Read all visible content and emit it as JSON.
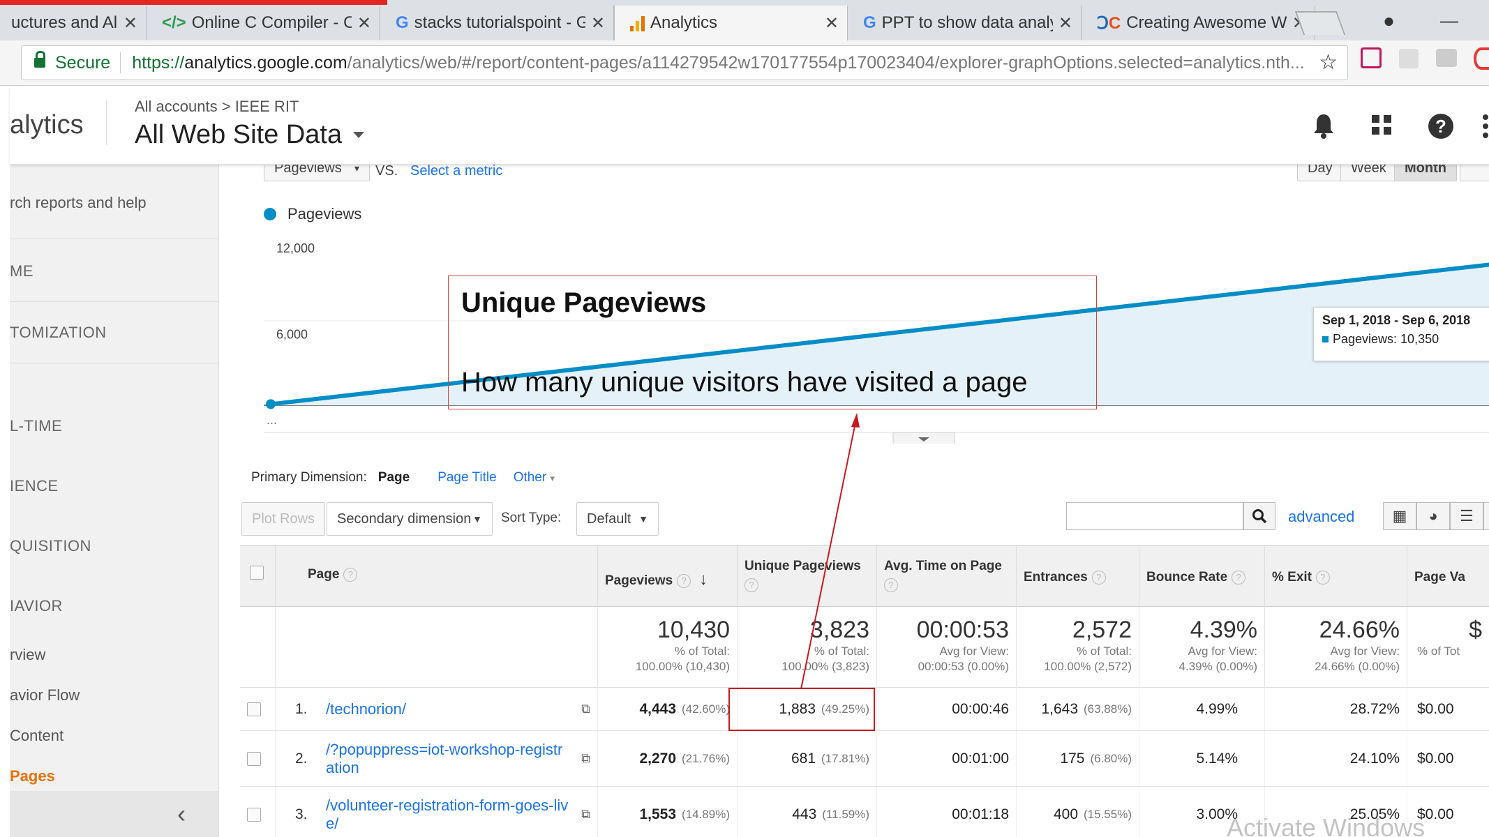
{
  "browser": {
    "tabs": [
      {
        "label": "uctures and Alg",
        "icon": "",
        "active": false
      },
      {
        "label": "Online C Compiler - Onl",
        "icon": "</>",
        "active": false
      },
      {
        "label": "stacks tutorialspoint - G",
        "icon": "G",
        "active": false
      },
      {
        "label": "Analytics",
        "icon": "analytics-bars",
        "active": true
      },
      {
        "label": "PPT to show data analyt",
        "icon": "G",
        "active": false
      },
      {
        "label": "Creating Awesome Web",
        "icon": "dc",
        "active": false
      }
    ],
    "close_glyph": "✕",
    "secure_label": "Secure",
    "url_proto": "https://",
    "url_host": "analytics.google.com",
    "url_path": "/analytics/web/#/report/content-pages/a114279542w170177554p170023404/explorer-graphOptions.selected=analytics.nth..."
  },
  "ga": {
    "brand": "alytics",
    "breadcrumb": "All accounts > IEEE RIT",
    "property": "All Web Site Data"
  },
  "sidebar": {
    "search": "rch reports and help",
    "home": "ME",
    "customization": "TOMIZATION",
    "realtime": "L-TIME",
    "audience": "IENCE",
    "acquisition": "QUISITION",
    "behavior": "IAVIOR",
    "overview": "rview",
    "behavior_flow": "avior Flow",
    "content": "Content",
    "pages": "Pages",
    "collapse": "‹"
  },
  "chart": {
    "metric_select": "Pageviews",
    "vs": "VS.",
    "select_metric": "Select a metric",
    "periods": [
      "Day",
      "Week",
      "Month"
    ],
    "legend": "Pageviews",
    "y_ticks": [
      "12,000",
      "6,000"
    ],
    "x_label": "...",
    "tooltip_date": "Sep 1, 2018 - Sep 6, 2018",
    "tooltip_value": "Pageviews: 10,350"
  },
  "chart_data": {
    "type": "area",
    "series": [
      {
        "name": "Pageviews",
        "values": [
          80,
          10350
        ]
      }
    ],
    "ylim": [
      0,
      12000
    ],
    "y_ticks": [
      6000,
      12000
    ]
  },
  "table_controls": {
    "primary_dimension_label": "Primary Dimension:",
    "dim_page": "Page",
    "dim_page_title": "Page Title",
    "dim_other": "Other",
    "plot_rows": "Plot Rows",
    "secondary_dimension": "Secondary dimension",
    "sort_type_label": "Sort Type:",
    "sort_type": "Default",
    "advanced": "advanced"
  },
  "table": {
    "headers": [
      "Page",
      "Pageviews",
      "Unique Pageviews",
      "Avg. Time on Page",
      "Entrances",
      "Bounce Rate",
      "% Exit",
      "Page Va"
    ],
    "totals": {
      "pageviews": {
        "big": "10,430",
        "l1": "% of Total:",
        "l2": "100.00% (10,430)"
      },
      "unique": {
        "big": "3,823",
        "l1": "% of Total:",
        "l2": "100.00% (3,823)"
      },
      "avgtime": {
        "big": "00:00:53",
        "l1": "Avg for View:",
        "l2": "00:00:53 (0.00%)"
      },
      "entrances": {
        "big": "2,572",
        "l1": "% of Total:",
        "l2": "100.00% (2,572)"
      },
      "bounce": {
        "big": "4.39%",
        "l1": "Avg for View:",
        "l2": "4.39% (0.00%)"
      },
      "exit": {
        "big": "24.66%",
        "l1": "Avg for View:",
        "l2": "24.66% (0.00%)"
      },
      "pageval": {
        "big": "$",
        "l1": "% of Tot",
        "l2": ""
      }
    },
    "rows": [
      {
        "idx": "1.",
        "page": "/technorion/",
        "pv": "4,443",
        "pv_pct": "(42.60%)",
        "upv": "1,883",
        "upv_pct": "(49.25%)",
        "time": "00:00:46",
        "ent": "1,643",
        "ent_pct": "(63.88%)",
        "bounce": "4.99%",
        "exit": "28.72%",
        "val": "$0.00"
      },
      {
        "idx": "2.",
        "page": "/?popuppress=iot-workshop-registration",
        "pv": "2,270",
        "pv_pct": "(21.76%)",
        "upv": "681",
        "upv_pct": "(17.81%)",
        "time": "00:01:00",
        "ent": "175",
        "ent_pct": "(6.80%)",
        "bounce": "5.14%",
        "exit": "24.10%",
        "val": "$0.00"
      },
      {
        "idx": "3.",
        "page": "/volunteer-registration-form-goes-live/",
        "pv": "1,553",
        "pv_pct": "(14.89%)",
        "upv": "443",
        "upv_pct": "(11.59%)",
        "time": "00:01:18",
        "ent": "400",
        "ent_pct": "(15.55%)",
        "bounce": "3.00%",
        "exit": "25.05%",
        "val": "$0.00"
      }
    ]
  },
  "annotation": {
    "title": "Unique Pageviews",
    "text": "How many unique visitors have visited a page"
  },
  "watermark": "Activate Windows",
  "colors": {
    "accent": "#058dc7",
    "annotation": "#c9191e",
    "link": "#1a73e8",
    "active_nav": "#e8710a"
  }
}
